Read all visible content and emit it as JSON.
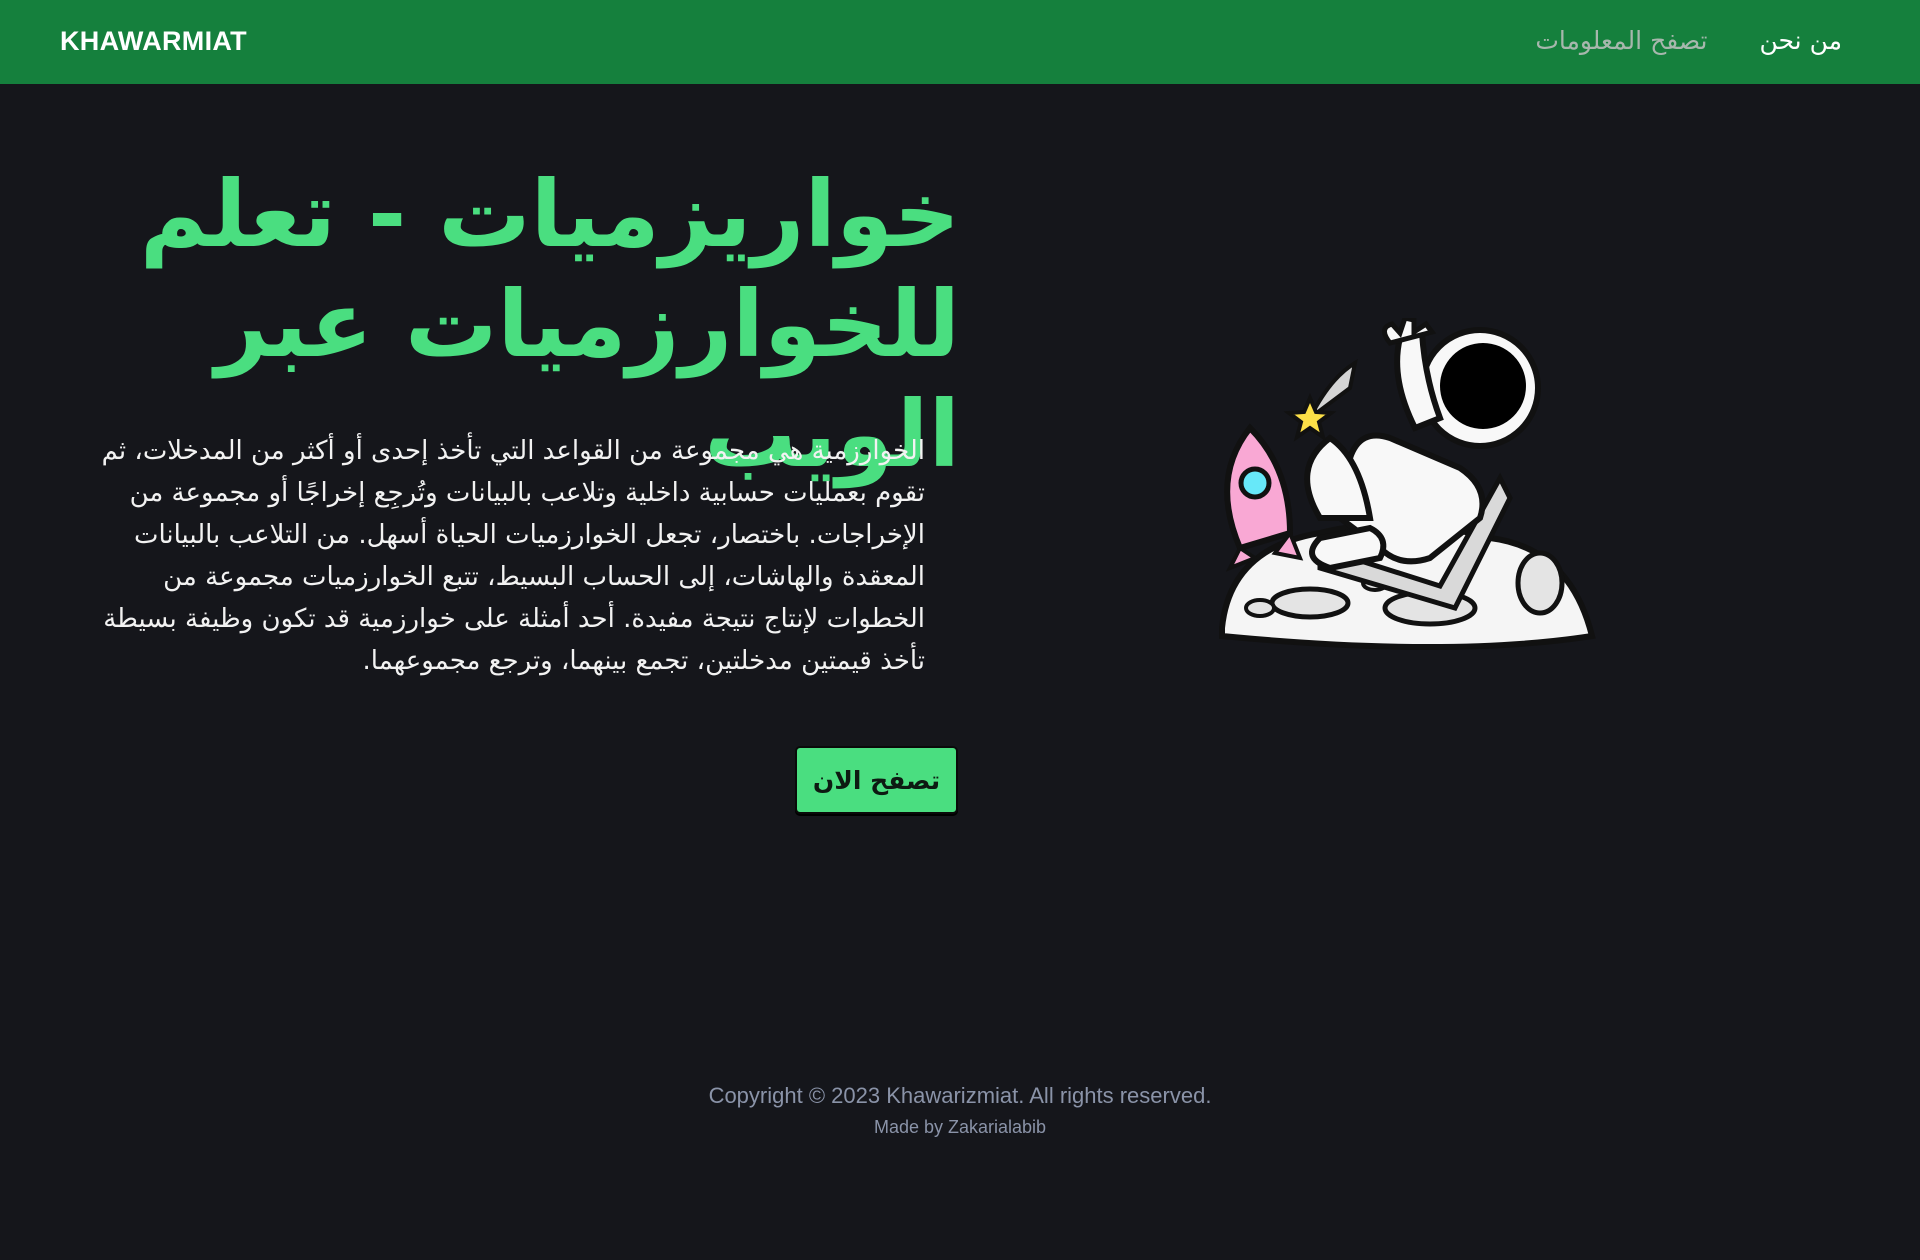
{
  "header": {
    "brand": "KHAWARMIAT",
    "nav": [
      {
        "label": "من نحن",
        "active": true
      },
      {
        "label": "تصفح المعلومات",
        "active": false
      }
    ]
  },
  "hero": {
    "title_line1": "خواريزميات - تعلم",
    "title_line2": "للخوارزميات عبر الويب",
    "description": "الخوارزمية هي مجموعة من القواعد التي تأخذ إحدى أو أكثر من المدخلات، ثم تقوم بعمليات حسابية داخلية وتلاعب بالبيانات وتُرجِع إخراجًا أو مجموعة من الإخراجات. باختصار، تجعل الخوارزميات الحياة أسهل. من التلاعب بالبيانات المعقدة والهاشات، إلى الحساب البسيط، تتبع الخوارزميات مجموعة من الخطوات لإنتاج نتيجة مفيدة. أحد أمثلة على خوارزمية قد تكون وظيفة بسيطة تأخذ قيمتين مدخلتين، تجمع بينهما، وترجع مجموعهما.",
    "cta_label": "تصفح الان",
    "illustration": "astronaut-on-moon-illustration"
  },
  "footer": {
    "copyright": "Copyright © 2023 Khawarizmiat. All rights reserved.",
    "made_by": "Made by Zakarialabib"
  },
  "colors": {
    "navbar": "#15803d",
    "background": "#15161b",
    "accent": "#4ade80",
    "footer_text": "#8a93a8"
  }
}
